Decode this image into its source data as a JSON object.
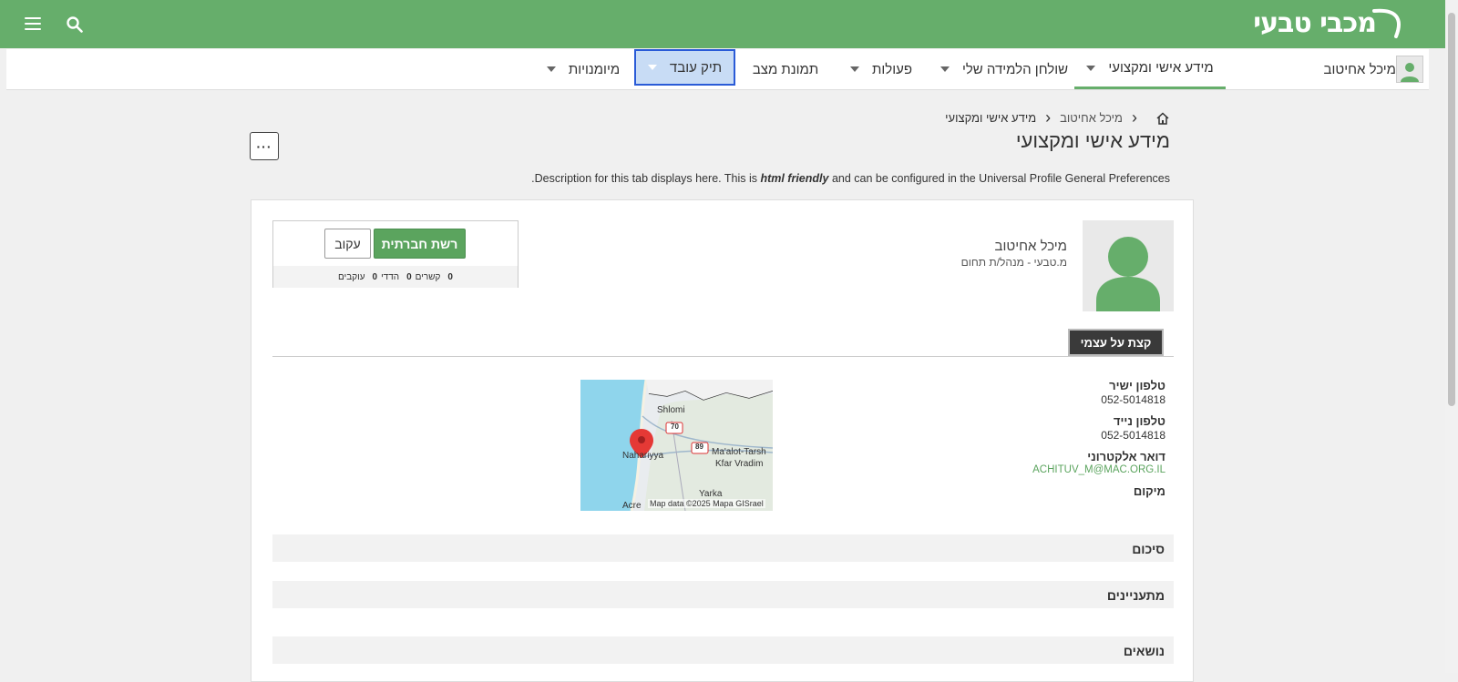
{
  "header": {
    "logo_text": "מכבי טבעי"
  },
  "nav": {
    "user_name": "מיכל אחיטוב",
    "items": [
      {
        "label": "מידע אישי ומקצועי"
      },
      {
        "label": "שולחן הלמידה שלי"
      },
      {
        "label": "פעולות"
      },
      {
        "label": "תמונת מצב"
      },
      {
        "label": "תיק עובד"
      },
      {
        "label": "מיומנויות"
      }
    ]
  },
  "breadcrumb": {
    "parent": "מיכל אחיטוב",
    "current": "מידע אישי ומקצועי"
  },
  "page": {
    "title": "מידע אישי ומקצועי",
    "more_label": "···",
    "description_start": "Description for this tab displays here. This is ",
    "description_em": "html friendly",
    "description_end": " and can be configured in the Universal Profile General Preferences."
  },
  "profile": {
    "name": "מיכל אחיטוב",
    "title": "מ.טבעי - מנהל/ת תחום"
  },
  "social": {
    "network_button": "רשת חברתית",
    "follow_button": "עקוב",
    "connections_count": "0",
    "connections_label": "קשרים",
    "mutual_count": "0",
    "mutual_label": "הדדי",
    "followers_count": "0",
    "followers_label": "עוקבים"
  },
  "tabs": {
    "about_me": "קצת על עצמי"
  },
  "contact": {
    "direct_phone_label": "טלפון ישיר",
    "direct_phone": "052-5014818",
    "mobile_phone_label": "טלפון נייד",
    "mobile_phone": "052-5014818",
    "email_label": "דואר אלקטרוני",
    "email": "ACHITUV_M@MAC.ORG.IL",
    "location_label": "מיקום"
  },
  "map": {
    "labels": {
      "shlomi": "Shlomi",
      "nahariyya": "Nahariyya",
      "maalot": "Ma'alot-Tarsh",
      "kfar_vradim": "Kfar Vradim",
      "yarka": "Yarka",
      "acre": "Acre",
      "road_70": "70",
      "road_89": "89",
      "attribution": "Map data ©2025 Mapa GISrael"
    }
  },
  "sections": {
    "summary": "סיכום",
    "interests": "מתעניינים",
    "topics": "נושאים"
  }
}
